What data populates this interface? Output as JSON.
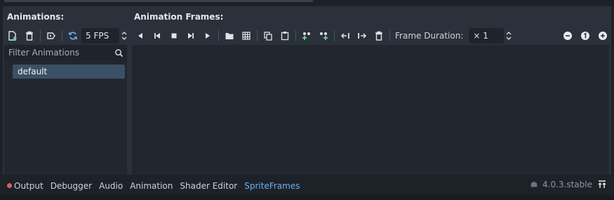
{
  "headers": {
    "animations": "Animations:",
    "frames": "Animation Frames:"
  },
  "toolbar": {
    "fps": "5 FPS",
    "frame_duration_label": "Frame Duration:",
    "frame_duration_value": "× 1"
  },
  "filter": {
    "placeholder": "Filter Animations"
  },
  "animations": [
    "default"
  ],
  "bottom_tabs": [
    "Output",
    "Debugger",
    "Audio",
    "Animation",
    "Shader Editor",
    "SpriteFrames"
  ],
  "active_tab": "SpriteFrames",
  "version": "4.0.3.stable",
  "colors": {
    "accent": "#6ab0f0",
    "add_green": "#6fd38f",
    "error_dot": "#e05c5c"
  }
}
